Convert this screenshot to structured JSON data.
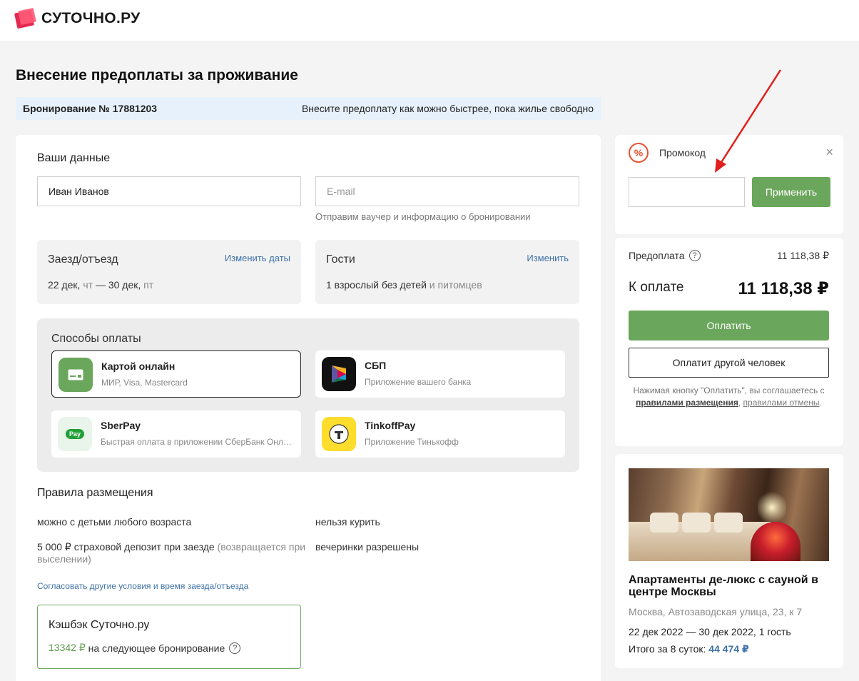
{
  "brand": {
    "name": "СУТОЧНО.РУ"
  },
  "page_title": "Внесение предоплаты за проживание",
  "booking": {
    "number": "Бронирование № 17881203",
    "notice": "Внесите предоплату как можно быстрее, пока жилье свободно"
  },
  "your_data": {
    "title": "Ваши данные",
    "name_value": "Иван Иванов",
    "email_placeholder": "E-mail",
    "email_hint": "Отправим ваучер и информацию о бронировании"
  },
  "dates": {
    "title": "Заезд/отъезд",
    "change": "Изменить даты",
    "checkin": "22 дек,",
    "checkin_day": "чт",
    "sep": "—",
    "checkout": "30 дек,",
    "checkout_day": "пт"
  },
  "guests": {
    "title": "Гости",
    "change": "Изменить",
    "value": "1 взрослый без детей",
    "value_muted": "и питомцев"
  },
  "payment": {
    "title": "Способы оплаты",
    "options": [
      {
        "name": "Картой онлайн",
        "sub": "МИР, Visa, Mastercard",
        "icon": "card-icon",
        "selected": true
      },
      {
        "name": "СБП",
        "sub": "Приложение вашего банка",
        "icon": "sbp-icon",
        "selected": false
      },
      {
        "name": "SberPay",
        "sub": "Быстрая оплата в приложении СберБанк Онлайн",
        "icon": "sberpay-icon",
        "selected": false
      },
      {
        "name": "TinkoffPay",
        "sub": "Приложение Тинькофф",
        "icon": "tinkoff-icon",
        "selected": false
      }
    ],
    "sberpay_badge": "Pay"
  },
  "rules": {
    "title": "Правила размещения",
    "kids": "можно с детьми любого возраста",
    "smoking": "нельзя курить",
    "deposit": "5 000 ₽ страховой депозит при заезде",
    "deposit_muted": "(возвращается при выселении)",
    "parties": "вечеринки разрешены",
    "other_link": "Согласовать другие условия и время заезда/отъезда"
  },
  "cashback": {
    "title": "Кэшбэк Суточно.ру",
    "amount": "13342 ₽",
    "text": "на следующее бронирование"
  },
  "promo": {
    "label": "Промокод",
    "icon_glyph": "%",
    "close": "×",
    "input_value": "",
    "apply": "Применить"
  },
  "summary": {
    "prepay_label": "Предоплата",
    "prepay_value": "11 118,38 ₽",
    "total_label": "К оплате",
    "total_value": "11 118,38 ₽",
    "pay_button": "Оплатить",
    "other_person_button": "Оплатит другой человек",
    "agree_pre": "Нажимая кнопку \"Оплатить\", вы соглашаетесь с",
    "agree_rules": "правилами размещения",
    "agree_comma": ",",
    "agree_cancel": "правилами отмены",
    "agree_dot": "."
  },
  "property": {
    "title": "Апартаменты де-люкс с сауной в центре Москвы",
    "address": "Москва, Автозаводская улица, 23, к 7",
    "dates": "22 дек 2022 — 30 дек 2022, 1 гость",
    "total_label": "Итого за 8 суток:",
    "total_value": "44 474 ₽"
  },
  "colors": {
    "accent_green": "#6aa65b",
    "link_blue": "#3f72a8",
    "brand_red": "#e32951",
    "annotation_arrow": "#e0201c"
  }
}
